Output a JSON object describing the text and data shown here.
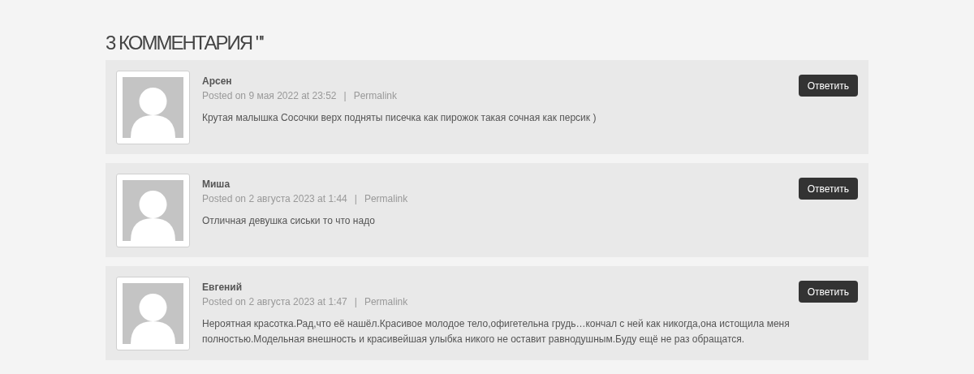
{
  "heading": "3 КОММЕНТАРИЯ \"'",
  "comments": [
    {
      "author": "Арсен",
      "posted": "Posted on 9 мая 2022 at 23:52",
      "separator": "|",
      "permalink": "Permalink",
      "text": "Крутая малышка Сосочки верх подняты писечка как пирожок такая сочная как персик )",
      "reply": "Ответить"
    },
    {
      "author": "Миша",
      "posted": "Posted on 2 августа 2023 at 1:44",
      "separator": "|",
      "permalink": "Permalink",
      "text": "Отличная девушка сиськи то что надо",
      "reply": "Ответить"
    },
    {
      "author": "Евгений",
      "posted": "Posted on 2 августа 2023 at 1:47",
      "separator": "|",
      "permalink": "Permalink",
      "text": "Нероятная красотка.Рад,что её нашёл.Красивое молодое тело,офигетельна грудь…кончал с ней как никогда,она истощила меня полностью.Модельная внешность и красивейшая улыбка никого не оставит равнодушным.Буду ещё не раз обращатся.",
      "reply": "Ответить"
    }
  ]
}
